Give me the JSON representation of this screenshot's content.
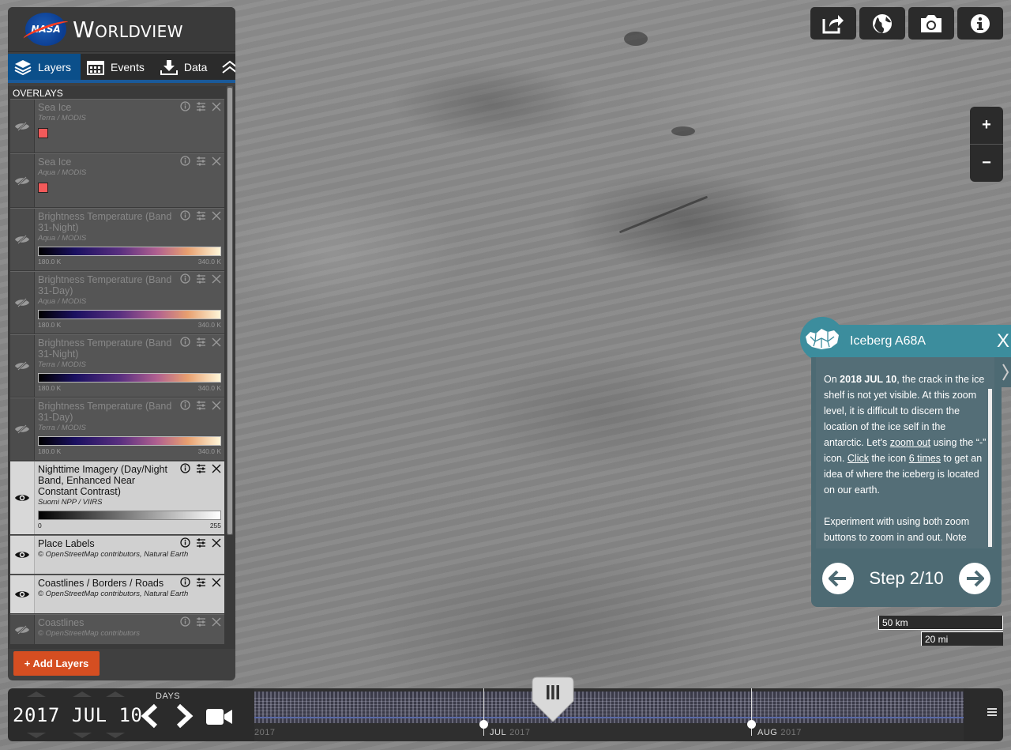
{
  "brand": {
    "agency": "NASA",
    "title": "Worldview"
  },
  "tabs": [
    {
      "label": "Layers",
      "icon": "layers-icon",
      "active": true
    },
    {
      "label": "Events",
      "icon": "calendar-icon",
      "active": false
    },
    {
      "label": "Data",
      "icon": "download-icon",
      "active": false
    }
  ],
  "overlays_header": "OVERLAYS",
  "layers": [
    {
      "name": "Sea Ice",
      "source": "Terra / MODIS",
      "visible": false,
      "legend": "swatch",
      "swatch_color": "#f35a5a"
    },
    {
      "name": "Sea Ice",
      "source": "Aqua / MODIS",
      "visible": false,
      "legend": "swatch",
      "swatch_color": "#f35a5a"
    },
    {
      "name": "Brightness Temperature (Band 31-Night)",
      "source": "Aqua / MODIS",
      "visible": false,
      "legend": "bt",
      "min": "180.0 K",
      "max": "340.0 K"
    },
    {
      "name": "Brightness Temperature (Band 31-Day)",
      "source": "Aqua / MODIS",
      "visible": false,
      "legend": "bt",
      "min": "180.0 K",
      "max": "340.0 K"
    },
    {
      "name": "Brightness Temperature (Band 31-Night)",
      "source": "Terra / MODIS",
      "visible": false,
      "legend": "bt",
      "min": "180.0 K",
      "max": "340.0 K"
    },
    {
      "name": "Brightness Temperature (Band 31-Day)",
      "source": "Terra / MODIS",
      "visible": false,
      "legend": "bt",
      "min": "180.0 K",
      "max": "340.0 K"
    },
    {
      "name": "Nighttime Imagery (Day/Night Band, Enhanced Near Constant Contrast)",
      "source": "Suomi NPP / VIIRS",
      "visible": true,
      "legend": "bw",
      "min": "0",
      "max": "255"
    },
    {
      "name": "Place Labels",
      "source": "© OpenStreetMap contributors, Natural Earth",
      "visible": true,
      "legend": "none"
    },
    {
      "name": "Coastlines / Borders / Roads",
      "source": "© OpenStreetMap contributors, Natural Earth",
      "visible": true,
      "legend": "none"
    },
    {
      "name": "Coastlines",
      "source": "© OpenStreetMap contributors",
      "visible": false,
      "legend": "none"
    }
  ],
  "add_layers_label": "+ Add Layers",
  "toolbar": [
    {
      "icon": "share-icon"
    },
    {
      "icon": "globe-icon"
    },
    {
      "icon": "camera-icon"
    },
    {
      "icon": "info-icon"
    }
  ],
  "zoom": {
    "in": "+",
    "out": "−"
  },
  "tour": {
    "title": "Iceberg A68A",
    "close": "X",
    "step_label": "Step 2/10",
    "text_parts": {
      "p1_a": "On ",
      "p1_date": "2018 JUL 10",
      "p1_b": ", the crack in the ice shelf is not yet visible. At this zoom level, it is difficult to discern the location of the ice self in the antarctic. Let's ",
      "p1_link1": "zoom out",
      "p1_c": " using the “-” icon. ",
      "p1_link2": "Click",
      "p1_d": " the icon ",
      "p1_link3": "6 times",
      "p1_e": " to get an idea of where the iceberg is located on our earth.",
      "p2": "Experiment with using both zoom buttons to zoom in and out. Note"
    }
  },
  "scale": {
    "km": "50 km",
    "mi": "20 mi"
  },
  "timeline": {
    "date": "2017 JUL 10",
    "interval": "DAYS",
    "months": [
      {
        "label": "JUL",
        "year": "2017"
      },
      {
        "label": "AUG",
        "year": "2017"
      }
    ],
    "left_year": "2017"
  },
  "colors": {
    "accent": "#0b4f8a",
    "tour": "#3c8d9d",
    "add_layers": "#d54e21"
  }
}
